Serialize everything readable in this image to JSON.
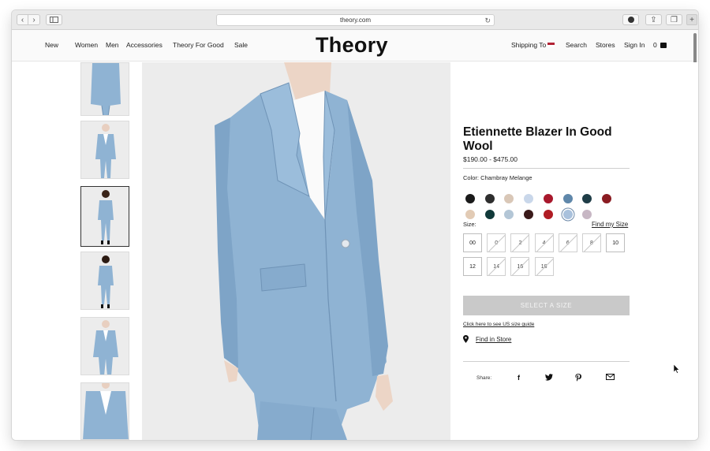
{
  "browser": {
    "url": "theory.com"
  },
  "header": {
    "nav_left": [
      "New",
      "Women",
      "Men",
      "Accessories",
      "Theory For Good",
      "Sale"
    ],
    "logo": "Theory",
    "shipping_label": "Shipping To",
    "search_label": "Search",
    "stores_label": "Stores",
    "signin_label": "Sign In",
    "cart_count": "0"
  },
  "product": {
    "title": "Etiennette Blazer In Good Wool",
    "price": "$190.00 - $475.00",
    "color_label": "Color: Chambray Melange",
    "swatches_row1": [
      "#1a1a1a",
      "#2e2e2e",
      "#d9c7b7",
      "#c9d7ea",
      "#a8182c",
      "#5f87aa",
      "#1f3d47",
      "#8a1c22"
    ],
    "swatches_row2": [
      "#e2cbb5",
      "#113a3a",
      "#b3c6d6",
      "#3a1a1a",
      "#b01c24",
      "#a9c1dc",
      "#c7b7c4"
    ],
    "selected_swatch_index_row2": 5,
    "size_label": "Size:",
    "find_size_label": "Find my Size",
    "sizes_row1": [
      "00",
      "0",
      "2",
      "4",
      "6",
      "8",
      "10"
    ],
    "sizes_row2": [
      "12",
      "14",
      "16",
      "18"
    ],
    "unavailable_sizes": [
      "0",
      "2",
      "4",
      "6",
      "8",
      "14",
      "16",
      "18"
    ],
    "select_button": "SELECT A SIZE",
    "size_guide_link": "Click here to see US size guide",
    "find_in_store": "Find in Store",
    "share_label": "Share:"
  },
  "colors": {
    "suit_blue": "#8fb3d3",
    "suit_shadow": "#6f93b6",
    "background_gray": "#ececec"
  },
  "icons": [
    "back-icon",
    "forward-icon",
    "sidebar-icon",
    "reload-icon",
    "download-icon",
    "share-icon",
    "tabs-icon",
    "plus-icon",
    "flag-icon",
    "bag-icon",
    "pin-icon",
    "facebook-icon",
    "twitter-icon",
    "pinterest-icon",
    "email-icon"
  ]
}
